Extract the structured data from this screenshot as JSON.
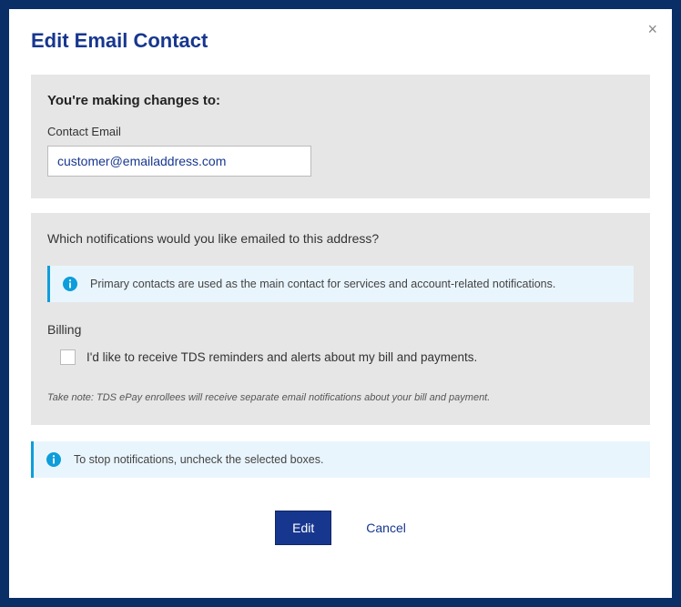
{
  "modal": {
    "title": "Edit Email Contact",
    "close_label": "×"
  },
  "section1": {
    "heading": "You're making changes to:",
    "field_label": "Contact Email",
    "email_value": "customer@emailaddress.com"
  },
  "section2": {
    "question": "Which notifications would you like emailed to this address?",
    "info_banner": "Primary contacts are used as the main contact for services and account-related notifications.",
    "billing_label": "Billing",
    "billing_checkbox_label": "I'd like to receive TDS reminders and alerts about my bill and payments.",
    "note": "Take note: TDS ePay enrollees will receive separate email notifications about your bill and payment."
  },
  "outer_info": "To stop notifications, uncheck the selected boxes.",
  "buttons": {
    "edit": "Edit",
    "cancel": "Cancel"
  }
}
